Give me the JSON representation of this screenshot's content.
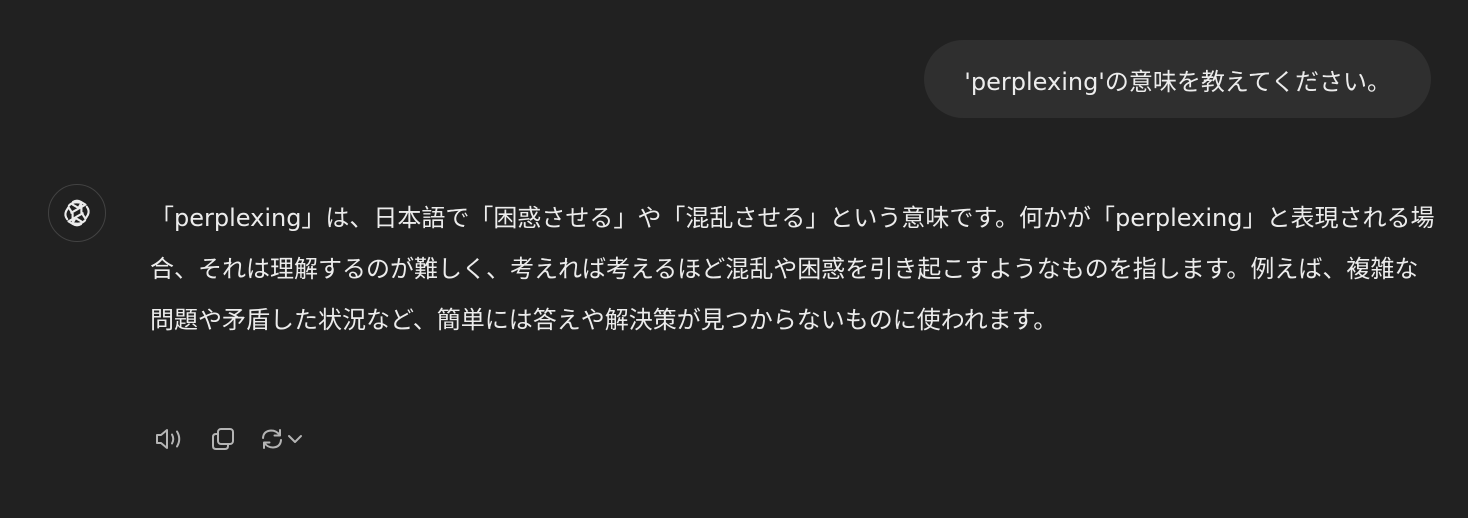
{
  "user_message": {
    "text": "'perplexing'の意味を教えてください。"
  },
  "assistant_message": {
    "avatar_icon": "openai-logo-icon",
    "text": "「perplexing」は、日本語で「困惑させる」や「混乱させる」という意味です。何かが「perplexing」と表現される場合、それは理解するのが難しく、考えれば考えるほど混乱や困惑を引き起こすようなものを指します。例えば、複雑な問題や矛盾した状況など、簡単には答えや解決策が見つからないものに使われます。"
  },
  "actions": {
    "read_aloud_icon": "speaker-icon",
    "copy_icon": "copy-icon",
    "regenerate_icon": "refresh-icon",
    "dropdown_icon": "chevron-down-icon"
  },
  "colors": {
    "background": "#212121",
    "user_bubble": "#2f2f2f",
    "text": "#ececec",
    "icon": "#b4b4b4"
  }
}
